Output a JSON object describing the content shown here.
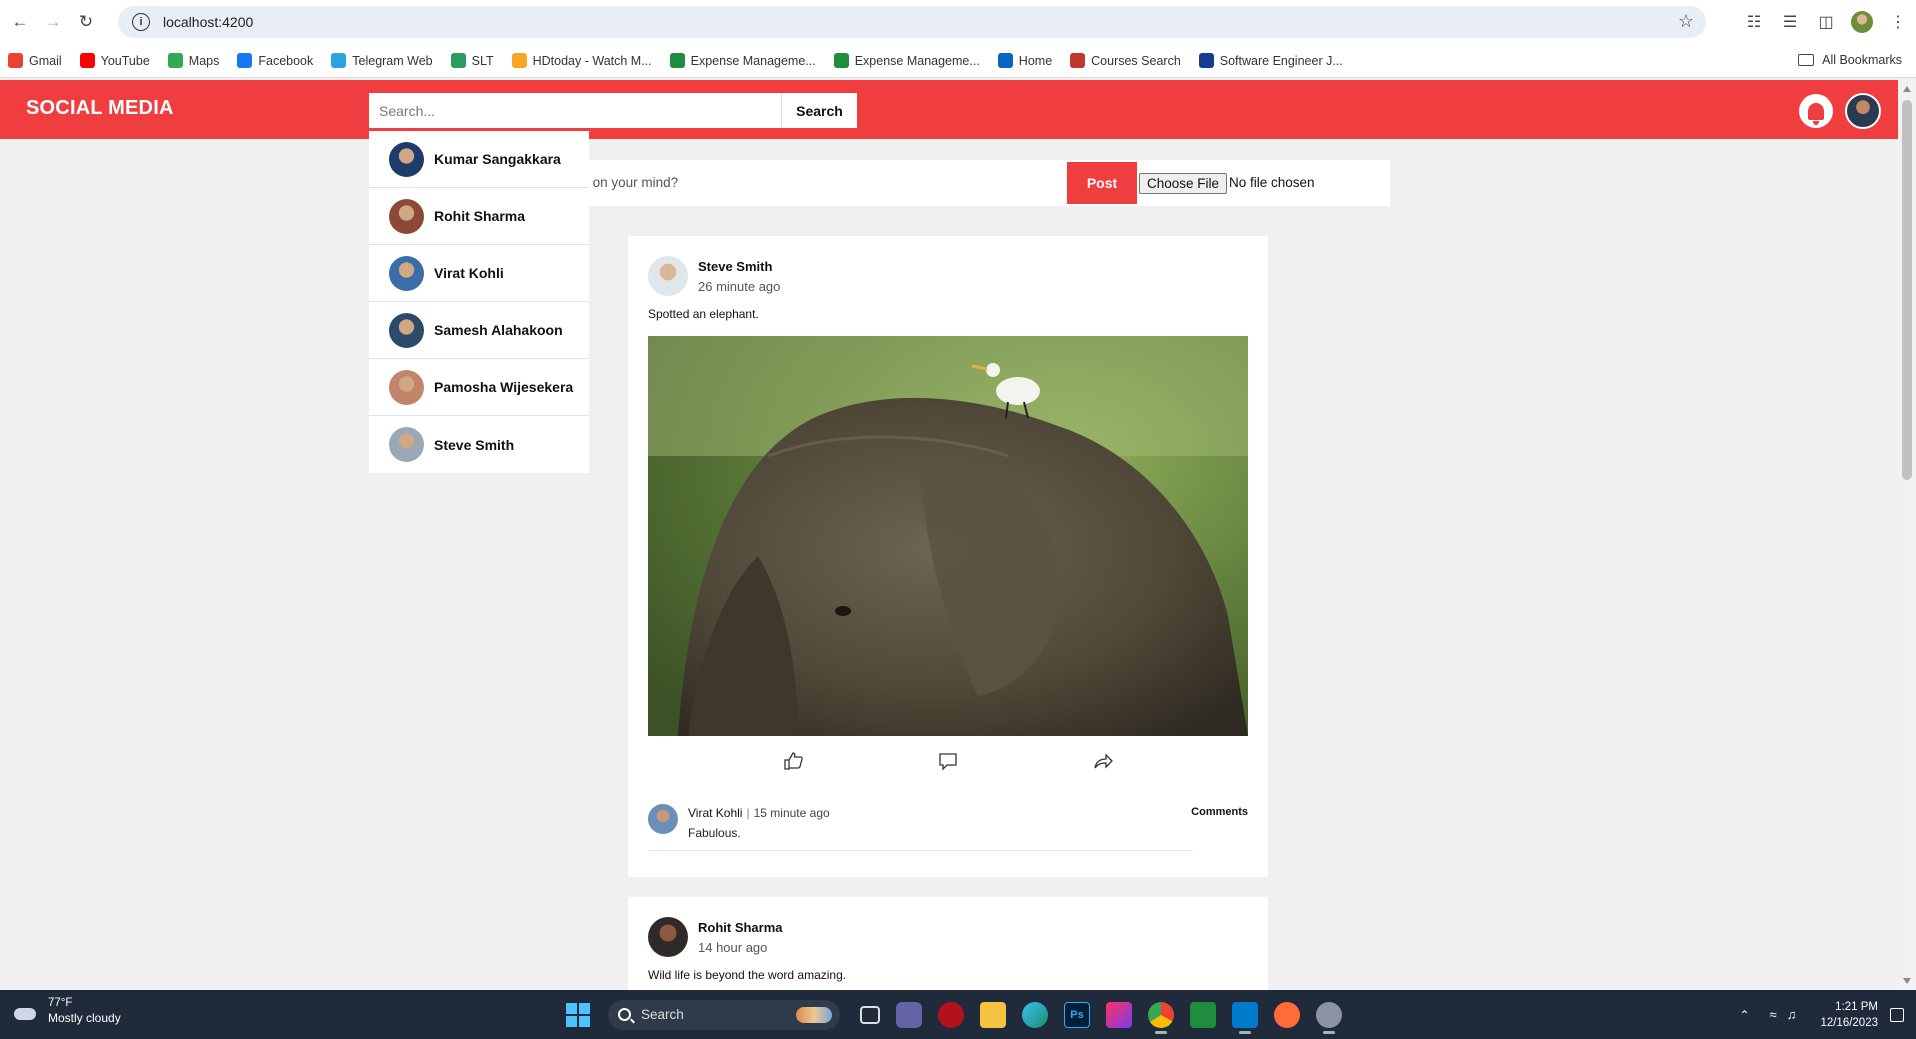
{
  "browser": {
    "url": "localhost:4200",
    "bookmarks": [
      {
        "label": "Gmail",
        "color": "#ea4335"
      },
      {
        "label": "YouTube",
        "color": "#ff0000"
      },
      {
        "label": "Maps",
        "color": "#34a853"
      },
      {
        "label": "Facebook",
        "color": "#1877f2"
      },
      {
        "label": "Telegram Web",
        "color": "#2aa3df"
      },
      {
        "label": "SLT",
        "color": "#2b9c5c"
      },
      {
        "label": "HDtoday - Watch M...",
        "color": "#f5a623"
      },
      {
        "label": "Expense Manageme...",
        "color": "#1e8e3e"
      },
      {
        "label": "Expense Manageme...",
        "color": "#1e8e3e"
      },
      {
        "label": "Home",
        "color": "#0a66c2"
      },
      {
        "label": "Courses Search",
        "color": "#c0392b"
      },
      {
        "label": "Software Engineer J...",
        "color": "#1a3c8f"
      }
    ],
    "all_bookmarks_label": "All Bookmarks"
  },
  "header": {
    "logo": "SOCIAL MEDIA",
    "search_placeholder": "Search...",
    "search_button": "Search",
    "accent": "#f03e40"
  },
  "search_results": [
    {
      "name": "Kumar Sangakkara",
      "avatar_color": "#1d3b6b"
    },
    {
      "name": "Rohit Sharma",
      "avatar_color": "#8a4a35"
    },
    {
      "name": "Virat Kohli",
      "avatar_color": "#3a6ea8"
    },
    {
      "name": "Samesh Alahakoon",
      "avatar_color": "#2c4a6a"
    },
    {
      "name": "Pamosha Wijesekera",
      "avatar_color": "#c0856a"
    },
    {
      "name": "Steve Smith",
      "avatar_color": "#9aa8b5"
    }
  ],
  "composer": {
    "placeholder_visible": "......'s on your mind?",
    "post_button": "Post",
    "file_button": "Choose File",
    "file_status": "No file chosen"
  },
  "posts": [
    {
      "author": "Steve Smith",
      "time": "26 minute ago",
      "text": "Spotted an elephant.",
      "comment": {
        "author": "Virat Kohli",
        "time": "15 minute ago",
        "text": "Fabulous."
      },
      "comments_link": "Comments"
    },
    {
      "author": "Rohit Sharma",
      "time": "14 hour ago",
      "text": "Wild life is beyond the word amazing."
    }
  ],
  "taskbar": {
    "temperature": "77°F",
    "weather": "Mostly cloudy",
    "search_label": "Search",
    "time": "1:21 PM",
    "date": "12/16/2023"
  }
}
